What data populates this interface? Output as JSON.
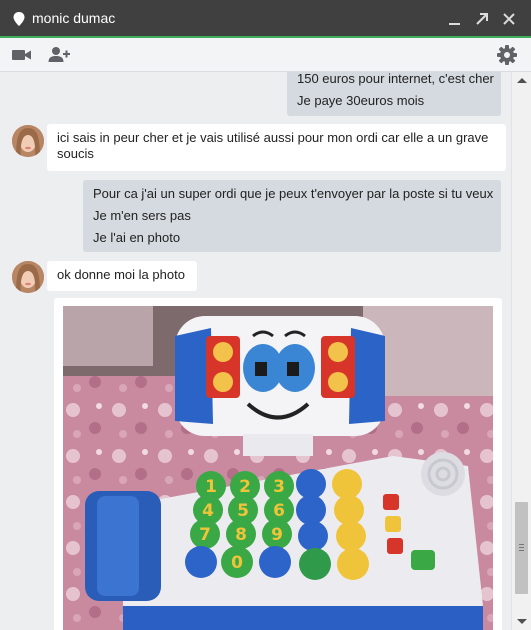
{
  "window": {
    "title": "monic dumac",
    "accent_color": "#3fae5f",
    "title_icon": "location-pin-icon",
    "controls": [
      "minimize-icon",
      "popout-icon",
      "close-icon"
    ]
  },
  "toolbar": {
    "left_icons": [
      "video-camera-icon",
      "add-person-icon"
    ],
    "right_icon": "gear-icon"
  },
  "messages": [
    {
      "direction": "outgoing",
      "lines": [
        "150 euros pour internet, c'est cher",
        "Je paye 30euros mois"
      ]
    },
    {
      "direction": "incoming",
      "text": "ici sais in peur cher et je vais utilisé aussi pour mon ordi car elle a un grave soucis"
    },
    {
      "direction": "outgoing",
      "lines": [
        "Pour ca j'ai un super ordi que je peux t'envoyer par la poste si tu veux",
        "Je m'en sers pas",
        "Je l'ai en photo"
      ]
    },
    {
      "direction": "incoming",
      "text": "ok donne moi la photo"
    },
    {
      "direction": "outgoing",
      "attachment": "photo of a toy children's laptop with a smiling face and colorful number buttons"
    }
  ],
  "photo_keypad": {
    "numbers": [
      "1",
      "2",
      "3",
      "4",
      "5",
      "6",
      "7",
      "8",
      "9",
      "0"
    ]
  }
}
